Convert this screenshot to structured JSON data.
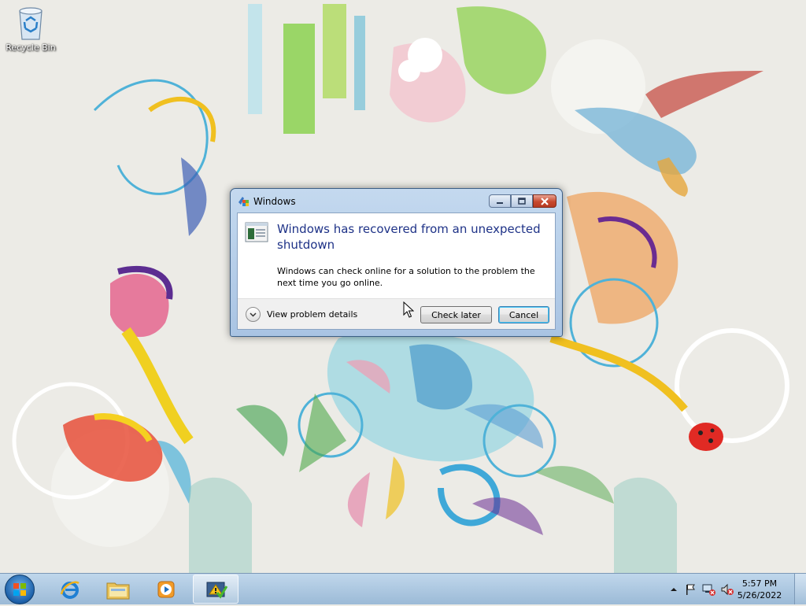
{
  "desktop": {
    "icons": [
      {
        "label": "Recycle Bin",
        "icon": "recycle-bin-icon"
      }
    ]
  },
  "dialog": {
    "title": "Windows",
    "headline": "Windows has recovered from an unexpected shutdown",
    "body": "Windows can check online for a solution to the problem the next time you go online.",
    "details_label": "View problem details",
    "check_later_label": "Check later",
    "cancel_label": "Cancel",
    "title_buttons": [
      "minimize-icon",
      "maximize-icon",
      "close-icon"
    ]
  },
  "taskbar": {
    "pinned": [
      "internet-explorer-icon",
      "windows-explorer-icon",
      "media-player-icon",
      "action-center-dialog-icon"
    ],
    "active_item": "action-center-dialog-icon",
    "tray_icons": [
      "show-hidden-icons-icon",
      "action-center-flag-icon",
      "network-icon",
      "volume-muted-icon"
    ],
    "clock_time": "5:57 PM",
    "clock_date": "5/26/2022"
  },
  "colors": {
    "headline": "#1e3287",
    "wallpaper_bg": "#ecebe6",
    "taskbar": "#a9c4e3"
  }
}
